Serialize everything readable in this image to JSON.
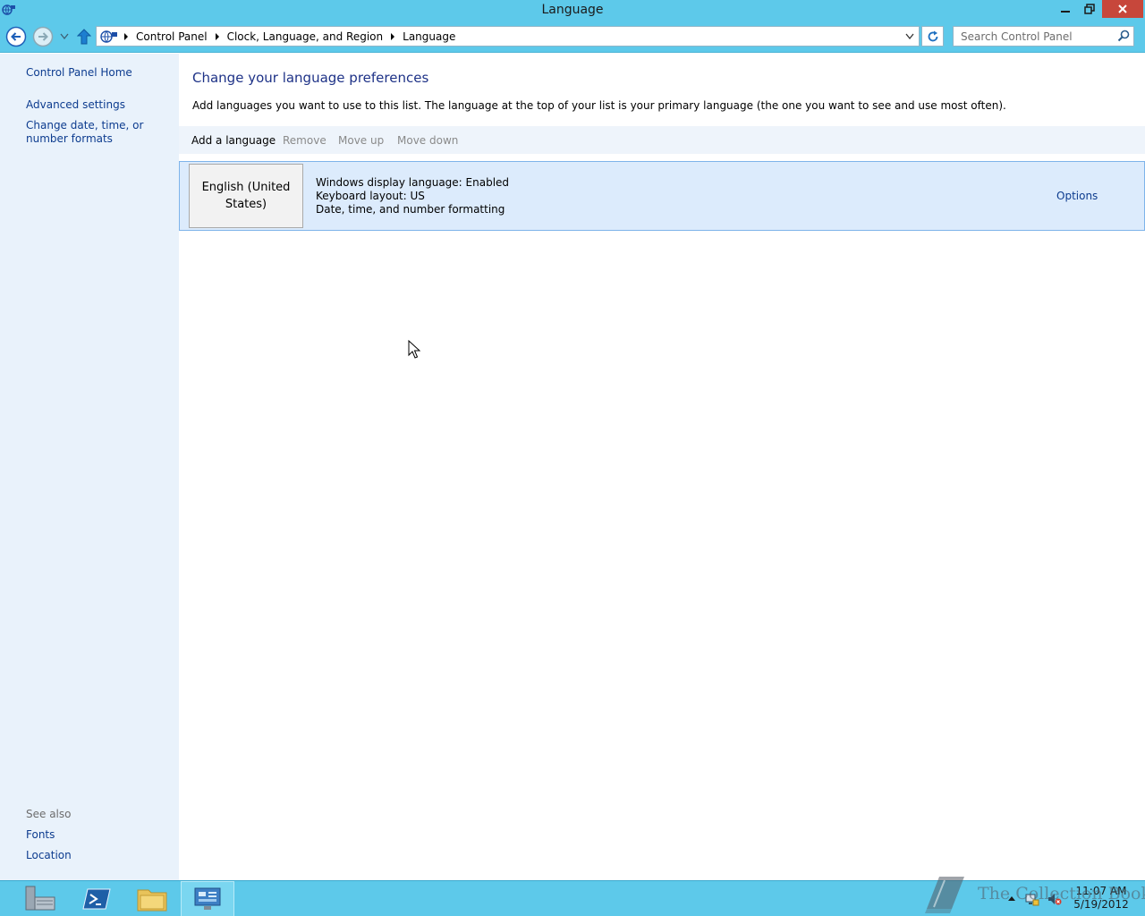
{
  "window": {
    "title": "Language"
  },
  "navigation": {
    "breadcrumbs": [
      "Control Panel",
      "Clock, Language, and Region",
      "Language"
    ],
    "search_placeholder": "Search Control Panel"
  },
  "left_pane": {
    "home_link": "Control Panel Home",
    "links": [
      "Advanced settings",
      "Change date, time, or number formats"
    ],
    "see_also_label": "See also",
    "see_also_links": [
      "Fonts",
      "Location"
    ]
  },
  "main": {
    "heading": "Change your language preferences",
    "description": "Add languages you want to use to this list. The language at the top of your list is your primary language (the one you want to see and use most often).",
    "toolbar": {
      "add": "Add a language",
      "remove": "Remove",
      "move_up": "Move up",
      "move_down": "Move down"
    },
    "languages": [
      {
        "name": "English (United States)",
        "details": [
          "Windows display language: Enabled",
          "Keyboard layout: US",
          "Date, time, and number formatting"
        ],
        "options_label": "Options"
      }
    ]
  },
  "taskbar": {
    "clock_time": "11:07 AM",
    "clock_date": "5/19/2012",
    "watermark": "The Collection Book"
  },
  "colors": {
    "title_bar": "#5dc9ea",
    "left_pane": "#e9f2fb",
    "link": "#0d3c8f",
    "heading": "#1e3287",
    "selected_row": "#dcebfc",
    "close_button": "#c7473b"
  }
}
